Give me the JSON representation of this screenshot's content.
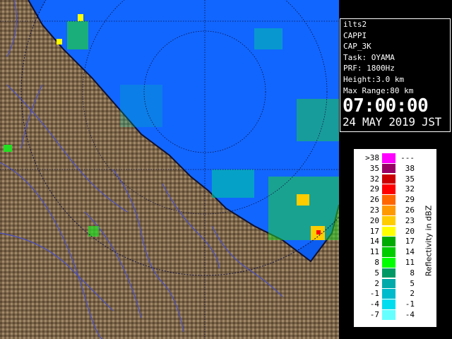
{
  "info": {
    "station": "ilts2",
    "product": "CAPPI",
    "scan": "CAP_3K",
    "task": "Task: OYAMA",
    "prf": "PRF: 1800Hz",
    "height": "Height:3.0 km",
    "max_range": "Max Range:80 km",
    "time": "07:00:00",
    "date": "24 MAY 2019 JST"
  },
  "legend": {
    "unit_label": "Reflectivity in dBZ",
    "rows": [
      {
        "low": ">38",
        "high": "---",
        "color": "#ff00ff"
      },
      {
        "low": "35",
        "high": "38",
        "color": "#990066"
      },
      {
        "low": "32",
        "high": "35",
        "color": "#cc0000"
      },
      {
        "low": "29",
        "high": "32",
        "color": "#ff0000"
      },
      {
        "low": "26",
        "high": "29",
        "color": "#ff6600"
      },
      {
        "low": "23",
        "high": "26",
        "color": "#ff9900"
      },
      {
        "low": "20",
        "high": "23",
        "color": "#ffcc00"
      },
      {
        "low": "17",
        "high": "20",
        "color": "#ffff00"
      },
      {
        "low": "14",
        "high": "17",
        "color": "#00aa00"
      },
      {
        "low": "11",
        "high": "14",
        "color": "#00cc00"
      },
      {
        "low": "8",
        "high": "11",
        "color": "#00ff00"
      },
      {
        "low": "5",
        "high": "8",
        "color": "#009966"
      },
      {
        "low": "2",
        "high": "5",
        "color": "#00aaaa"
      },
      {
        "low": "-1",
        "high": "2",
        "color": "#00bbcc"
      },
      {
        "low": "-4",
        "high": "-1",
        "color": "#00ddee"
      },
      {
        "low": "-7",
        "high": "-4",
        "color": "#66ffff"
      }
    ]
  },
  "colors": {
    "sea": "#0b5cf0",
    "land": "#7a6448",
    "coast": "#101030",
    "grid": "#101040",
    "rivers": "#4a50c8",
    "echo_light": "#00c8a0",
    "echo_mid": "#22dd22",
    "echo_strong": "#ffcc00"
  }
}
